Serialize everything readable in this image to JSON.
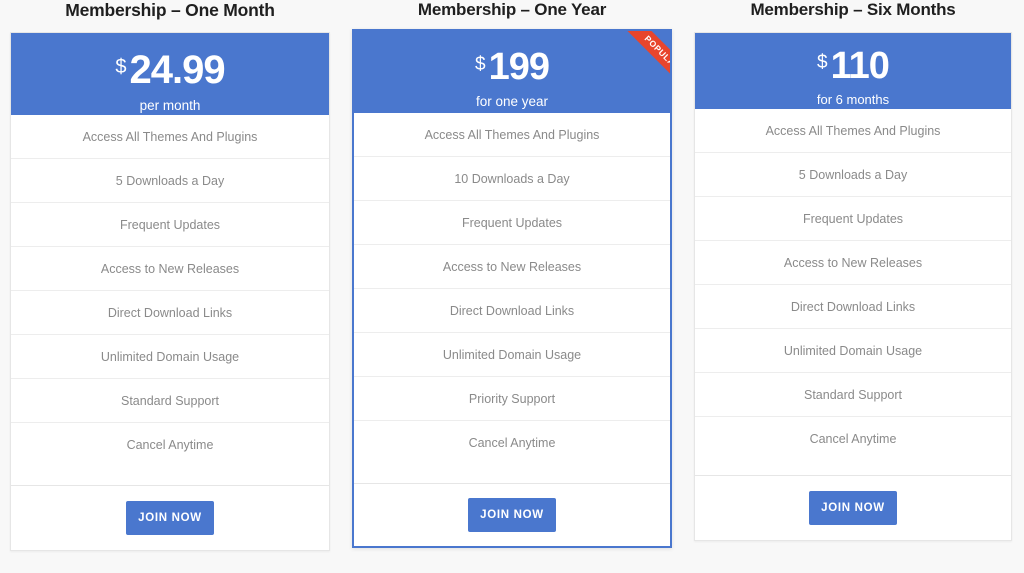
{
  "page": {
    "background_color": "#f8f8f8",
    "accent_color": "#4a77ce",
    "ribbon_color": "#e8452c",
    "feature_text_color": "#8a8a8a",
    "title_color": "#1f1f1f"
  },
  "plans": [
    {
      "title": "Membership – One Month",
      "currency": "$",
      "amount": "24.99",
      "period": "per month",
      "badge": null,
      "featured": false,
      "features": [
        "Access All Themes And Plugins",
        "5 Downloads a Day",
        "Frequent Updates",
        "Access to New Releases",
        "Direct Download Links",
        "Unlimited Domain Usage",
        "Standard Support",
        "Cancel Anytime"
      ],
      "cta_label": "JOIN NOW"
    },
    {
      "title": "Membership – One Year",
      "currency": "$",
      "amount": "199",
      "period": "for one year",
      "badge": "POPULAR",
      "featured": true,
      "features": [
        "Access All Themes And Plugins",
        "10 Downloads a Day",
        "Frequent Updates",
        "Access to New Releases",
        "Direct Download Links",
        "Unlimited Domain Usage",
        "Priority Support",
        "Cancel Anytime"
      ],
      "cta_label": "JOIN NOW"
    },
    {
      "title": "Membership – Six Months",
      "currency": "$",
      "amount": "110",
      "period": "for 6 months",
      "badge": null,
      "featured": false,
      "features": [
        "Access All Themes And Plugins",
        "5 Downloads a Day",
        "Frequent Updates",
        "Access to New Releases",
        "Direct Download Links",
        "Unlimited Domain Usage",
        "Standard Support",
        "Cancel Anytime"
      ],
      "cta_label": "JOIN NOW"
    }
  ]
}
